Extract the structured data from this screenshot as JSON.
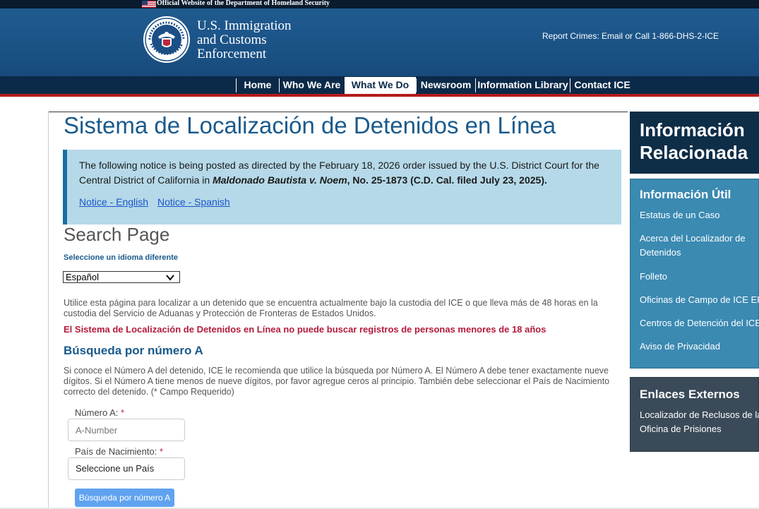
{
  "official_banner": {
    "text": "Official Website of the Department of Homeland Security"
  },
  "header": {
    "brand_line1": "U.S. Immigration",
    "brand_line2": "and Customs",
    "brand_line3": "Enforcement",
    "report_text": "Report Crimes: Email or Call 1-866-DHS-2-ICE"
  },
  "nav": {
    "items": [
      {
        "label": "Home"
      },
      {
        "label": "Who We Are"
      },
      {
        "label": "What We Do",
        "active": true
      },
      {
        "label": "Newsroom"
      },
      {
        "label": "Information Library"
      },
      {
        "label": "Contact ICE"
      }
    ]
  },
  "main": {
    "title": "Sistema de Localización de Detenidos en Línea",
    "notice": {
      "text_before": "The following notice is being posted as directed by the February 18, 2026 order issued by the U.S. District Court for the Central District of California in ",
      "case_name": "Maldonado Bautista v. Noem",
      "case_number": ", No. 25-1873 (C.D. Cal. filed July 23, 2025).",
      "link_english": "Notice - English",
      "link_spanish": "Notice - Spanish"
    },
    "search_page_heading": "Search Page",
    "language_label": "Seleccione un idioma diferente",
    "language_selected": "Español",
    "intro": "Utilice esta página para localizar a un detenido que se encuentra actualmente bajo la custodia del ICE o que lleva más de 48 horas en la custodia del Servicio de Aduanas y Protección de Fronteras de Estados Unidos.",
    "warning": "El Sistema de Localización de Detenidos en Línea no puede buscar registros de personas menores de 18 años",
    "section_title": "Búsqueda por número A",
    "section_desc": "Si conoce el Número A del detenido, ICE le recomienda que utilice la búsqueda por Número A. El Número A debe tener exactamente nueve dígitos. Si el Número A tiene menos de nueve dígitos, por favor agregue ceros al principio. También debe seleccionar el País de Nacimiento correcto del detenido. (* Campo Requerido)",
    "a_number_label": "Número A:",
    "a_number_placeholder": "A-Number",
    "country_label": "País de Nacimiento:",
    "country_selected": "Seleccione un País",
    "required_mark": "*",
    "search_button": "Búsqueda por número A"
  },
  "sidebar": {
    "related_title": "Información Relacionada",
    "useful_title": "Información Útil",
    "useful_links": [
      "Estatus de un Caso",
      "Acerca del Localizador de Detenidos",
      "Folleto",
      "Oficinas de Campo de ICE ERO",
      "Centros de Detención del ICE",
      "Aviso de Privacidad"
    ],
    "external_title": "Enlaces Externos",
    "external_links": [
      "Localizador de Reclusos de la Oficina de Prisiones"
    ]
  },
  "colors": {
    "header_blue": "#1b5286",
    "nav_navy": "#0b2a49",
    "title_blue": "#1a5a8c",
    "warning_red": "#b31b3b",
    "notice_bg": "#b5d9e8",
    "sidebar_teal": "#3b8ab2",
    "sidebar_dark": "#0e2d47",
    "button_blue": "#5fa3f0"
  }
}
